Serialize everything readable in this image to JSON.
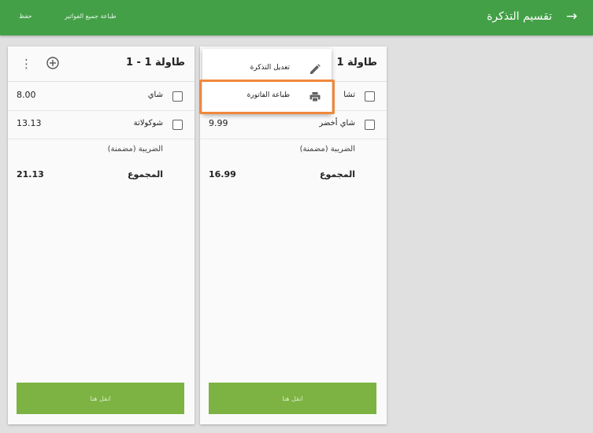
{
  "header": {
    "title": "تقسيم التذكرة",
    "print_all_label": "طباعة جميع الفواتير",
    "save_label": "حفظ"
  },
  "tickets": [
    {
      "title": "طاولة 1 - 1",
      "items": [
        {
          "name": "شاي",
          "price": "8.00"
        },
        {
          "name": "شوكولاتة",
          "price": "13.13"
        }
      ],
      "tax_label": "الضريبة (مضمنة)",
      "total_label": "المجموع",
      "total": "21.13",
      "move_label": "انقل هنا"
    },
    {
      "title": "طاولة 1",
      "items": [
        {
          "name": "تشا",
          "price": ""
        },
        {
          "name": "شاي أخضر",
          "price": "9.99"
        }
      ],
      "tax_label": "الضريبة (مضمنة)",
      "total_label": "المجموع",
      "total": "16.99",
      "move_label": "انقل هنا"
    }
  ],
  "context_menu": {
    "items": [
      {
        "label": "تعديل التذكرة",
        "icon": "pencil-icon"
      },
      {
        "label": "طباعة الفاتورة",
        "icon": "printer-icon"
      }
    ]
  },
  "colors": {
    "primary": "#43a047",
    "button": "#7cb342",
    "highlight": "#f0883c"
  }
}
